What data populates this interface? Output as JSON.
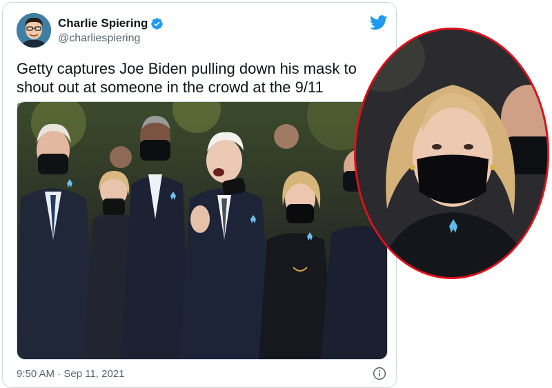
{
  "tweet": {
    "author": {
      "name": "Charlie Spiering",
      "handle": "@charliespiering",
      "verified": true
    },
    "text": "Getty captures Joe Biden pulling down his mask to shout out at someone in the crowd at the 9/11 ceremony",
    "timestamp": "9:50 AM · Sep 11, 2021"
  },
  "icons": {
    "logo": "twitter-bird-icon",
    "verified": "verified-badge-icon",
    "info": "info-icon"
  },
  "colors": {
    "twitter_blue": "#1d9bf0",
    "highlight_ring": "#e0101a",
    "text_primary": "#0f1419",
    "text_secondary": "#536471"
  }
}
